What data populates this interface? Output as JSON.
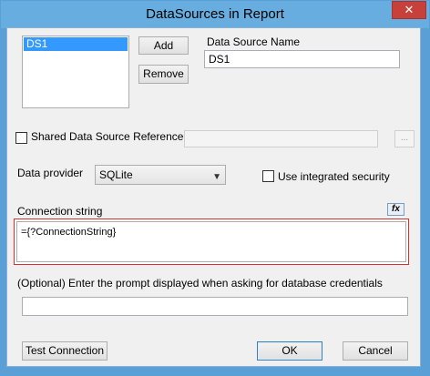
{
  "window": {
    "title": "DataSources in Report",
    "close_glyph": "✕"
  },
  "datasources": {
    "items": [
      "DS1"
    ],
    "add_label": "Add",
    "remove_label": "Remove"
  },
  "name": {
    "label": "Data Source Name",
    "value": "DS1"
  },
  "shared": {
    "label": "Shared Data Source Reference",
    "checked": false,
    "value": "",
    "browse_label": "..."
  },
  "provider": {
    "label": "Data provider",
    "selected": "SQLite"
  },
  "integrated_security": {
    "label": "Use integrated security",
    "checked": false
  },
  "connection": {
    "label": "Connection string",
    "fx_label": "fx",
    "value": "={?ConnectionString}"
  },
  "prompt": {
    "label": "(Optional) Enter the prompt displayed when asking for database credentials",
    "value": ""
  },
  "footer": {
    "test_label": "Test Connection",
    "ok_label": "OK",
    "cancel_label": "Cancel"
  },
  "colors": {
    "title_bar": "#67addf",
    "close_button": "#c8403a",
    "selection": "#3399ff",
    "highlight_border": "#d9322a"
  }
}
